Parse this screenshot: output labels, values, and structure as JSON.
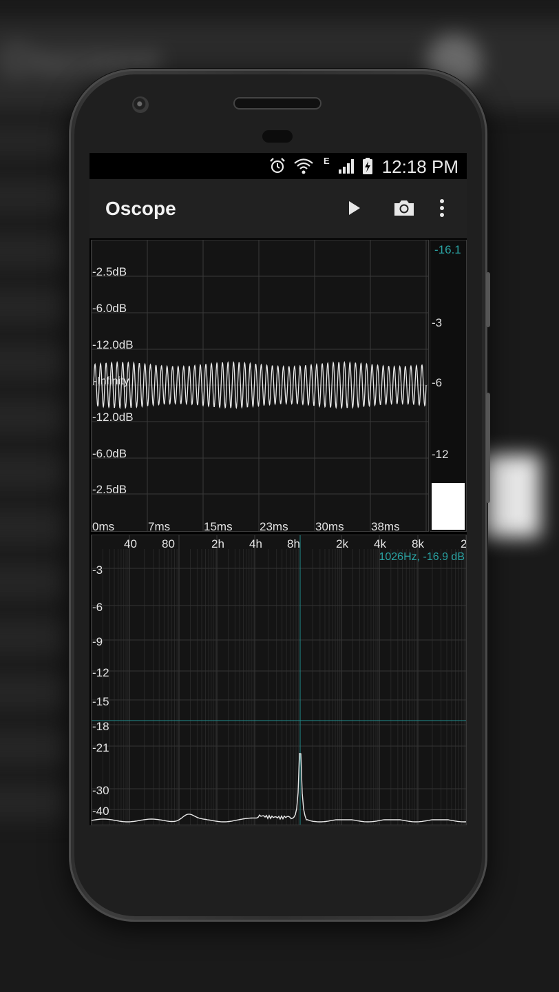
{
  "status_bar": {
    "time": "12:18 PM",
    "network_label": "E",
    "icons": [
      "alarm-icon",
      "wifi-icon",
      "signal-icon",
      "battery-charging-icon"
    ]
  },
  "app_bar": {
    "title": "Oscope",
    "actions": [
      "play-icon",
      "camera-icon",
      "overflow-menu-icon"
    ]
  },
  "oscilloscope": {
    "db_labels_top": [
      "-2.5dB",
      "-6.0dB",
      "-12.0dB"
    ],
    "center_label": "-Infinity",
    "db_labels_bottom": [
      "-12.0dB",
      "-6.0dB",
      "-2.5dB"
    ],
    "time_labels": [
      "0ms",
      "7ms",
      "15ms",
      "23ms",
      "30ms",
      "38ms"
    ],
    "wave_color": "#e8e8e8",
    "grid_color": "#3a3a3a"
  },
  "level_meter": {
    "peak_readout": "-16.1",
    "scale_labels": [
      "-3",
      "-6",
      "-12"
    ],
    "fill_fraction": 0.16,
    "peak_color": "#2aa3a3"
  },
  "spectrum": {
    "freq_labels": [
      "40",
      "80",
      "2h",
      "4h",
      "8h",
      "2k",
      "4k",
      "8k",
      "2"
    ],
    "db_labels": [
      "-3",
      "-6",
      "-9",
      "-12",
      "-15",
      "-18",
      "-21",
      "-30",
      "-40"
    ],
    "cursor_readout": "1026Hz, -16.9 dB",
    "cursor_color": "#2aa3a3",
    "peak_frequency_hz": 1026,
    "peak_level_db": -16.9
  }
}
